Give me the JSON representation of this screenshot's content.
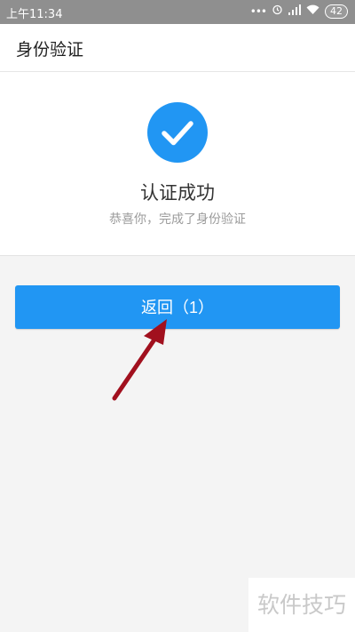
{
  "statusbar": {
    "time": "上午11:34",
    "battery": "42",
    "icons": [
      "more-dots-icon",
      "alarm-icon",
      "signal-icon",
      "wifi-icon",
      "battery-icon"
    ]
  },
  "header": {
    "title": "身份验证"
  },
  "result": {
    "icon": "check-circle-icon",
    "title": "认证成功",
    "subtitle": "恭喜你，完成了身份验证"
  },
  "action": {
    "return_label": "返回（1）"
  },
  "annotation": {
    "arrow_color": "#a1101e"
  },
  "watermark": {
    "text": "软件技巧"
  },
  "colors": {
    "accent": "#2196f3",
    "statusbar": "#8f8f8f"
  }
}
